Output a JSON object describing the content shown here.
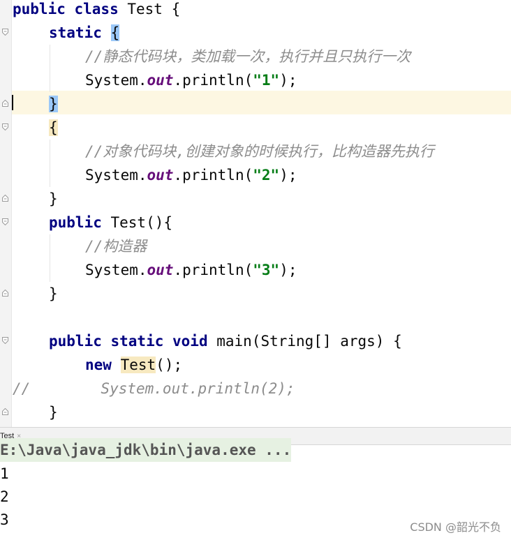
{
  "editor": {
    "lines": [
      {
        "t1": "public",
        "t2": " class",
        "t3": " Test {"
      },
      {
        "t1": "static",
        "t3": " ",
        "brace": "{"
      },
      {
        "comment": "//静态代码块，类加载一次，执行并且只执行一次"
      },
      {
        "pre": "System.",
        "fld": "out",
        "post": ".println(",
        "str": "\"1\"",
        "end": ");"
      },
      {
        "brace": "}"
      },
      {
        "brace": "{"
      },
      {
        "comment": "//对象代码块,创建对象的时候执行，比构造器先执行"
      },
      {
        "pre": "System.",
        "fld": "out",
        "post": ".println(",
        "str": "\"2\"",
        "end": ");"
      },
      {
        "brace": "}"
      },
      {
        "kw": "public",
        "rest": " Test(){"
      },
      {
        "comment": "//构造器"
      },
      {
        "pre": "System.",
        "fld": "out",
        "post": ".println(",
        "str": "\"3\"",
        "end": ");"
      },
      {
        "brace": "}"
      },
      {
        "blank": ""
      },
      {
        "kw1": "public",
        "kw2": " static",
        "kw3": " void",
        "rest": " main(String[] args) {"
      },
      {
        "kw": "new",
        "sp": " ",
        "call": "Test",
        "rest": "();"
      },
      {
        "comment": "//        System.out.println(2);"
      },
      {
        "brace": "}"
      }
    ]
  },
  "tab": {
    "label": "Test",
    "close": "×"
  },
  "console": {
    "command": "E:\\Java\\java_jdk\\bin\\java.exe ...",
    "outputs": [
      "1",
      "2",
      "3"
    ]
  },
  "watermark": "CSDN @韶光不负"
}
